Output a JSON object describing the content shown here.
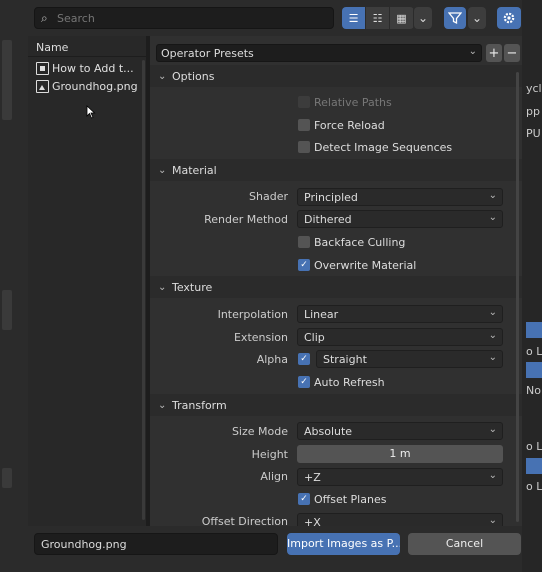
{
  "toolbar": {
    "search_placeholder": "Search",
    "search_icon": "search-icon",
    "view_modes": [
      "list-vertical-icon",
      "list-horizontal-icon",
      "thumbnails-icon"
    ],
    "view_dropdown": "⌄",
    "filter_icon": "filter-icon",
    "settings_icon": "gear-icon"
  },
  "file_list": {
    "header": "Name",
    "items": [
      {
        "label": "How to Add t...",
        "icon": "film-icon"
      },
      {
        "label": "Groundhog.png",
        "icon": "image-icon"
      }
    ]
  },
  "operator_presets": {
    "label": "Operator Presets",
    "add": "+",
    "remove": "−"
  },
  "sections": {
    "options": {
      "title": "Options",
      "relative_paths": {
        "label": "Relative Paths",
        "checked": false,
        "enabled": false
      },
      "force_reload": {
        "label": "Force Reload",
        "checked": false
      },
      "detect_sequences": {
        "label": "Detect Image Sequences",
        "checked": false
      }
    },
    "material": {
      "title": "Material",
      "shader_label": "Shader",
      "shader_value": "Principled",
      "render_method_label": "Render Method",
      "render_method_value": "Dithered",
      "backface_culling": {
        "label": "Backface Culling",
        "checked": false
      },
      "overwrite_material": {
        "label": "Overwrite Material",
        "checked": true
      }
    },
    "texture": {
      "title": "Texture",
      "interpolation_label": "Interpolation",
      "interpolation_value": "Linear",
      "extension_label": "Extension",
      "extension_value": "Clip",
      "alpha_label": "Alpha",
      "alpha_checked": true,
      "alpha_value": "Straight",
      "auto_refresh": {
        "label": "Auto Refresh",
        "checked": true
      }
    },
    "transform": {
      "title": "Transform",
      "size_mode_label": "Size Mode",
      "size_mode_value": "Absolute",
      "height_label": "Height",
      "height_value": "1 m",
      "align_label": "Align",
      "align_value": "+Z",
      "offset_planes": {
        "label": "Offset Planes",
        "checked": true
      },
      "offset_direction_label": "Offset Direction",
      "offset_direction_value": "+X"
    }
  },
  "footer": {
    "filename": "Groundhog.png",
    "import_label": "Import Images as P...",
    "cancel_label": "Cancel"
  },
  "background_fragments": [
    "ycle",
    "pp",
    "PU",
    "o L",
    "No",
    "o L",
    "o L"
  ],
  "colors": {
    "accent": "#4772b3",
    "panel": "#303030",
    "header": "#2b2b2b",
    "field": "#1d1d1d"
  }
}
